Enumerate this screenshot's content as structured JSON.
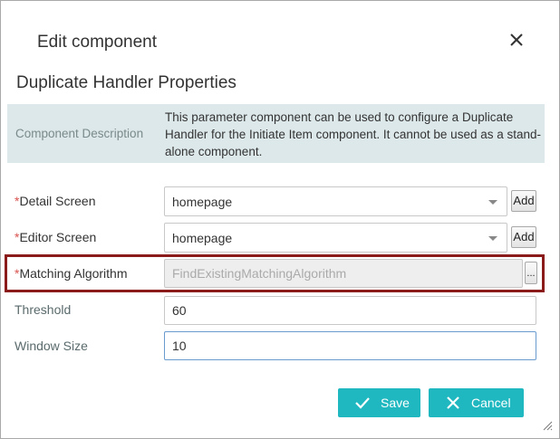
{
  "dialog": {
    "title": "Edit component",
    "close_icon": "close-icon"
  },
  "section": {
    "title": "Duplicate Handler Properties"
  },
  "description": {
    "label": "Component Description",
    "text": "This parameter component can be used to configure a Duplicate Handler for the Initiate Item component. It cannot be used as a stand-alone component."
  },
  "fields": {
    "detail_screen": {
      "required_mark": "*",
      "label": "Detail Screen",
      "value": "homepage",
      "add_label": "Add"
    },
    "editor_screen": {
      "required_mark": "*",
      "label": "Editor Screen",
      "value": "homepage",
      "add_label": "Add"
    },
    "matching_algorithm": {
      "required_mark": "*",
      "label": "Matching Algorithm",
      "value": "FindExistingMatchingAlgorithm",
      "browse_label": "..."
    },
    "threshold": {
      "label": "Threshold",
      "value": "60"
    },
    "window_size": {
      "label": "Window Size",
      "value": "10"
    }
  },
  "buttons": {
    "save": {
      "label": "Save",
      "icon": "checkmark-icon"
    },
    "cancel": {
      "label": "Cancel",
      "icon": "x-icon"
    }
  },
  "colors": {
    "accent": "#1fb8c0",
    "required": "#d9534f",
    "highlight_border": "#8b1a1a",
    "description_bg": "#dde8ea"
  }
}
